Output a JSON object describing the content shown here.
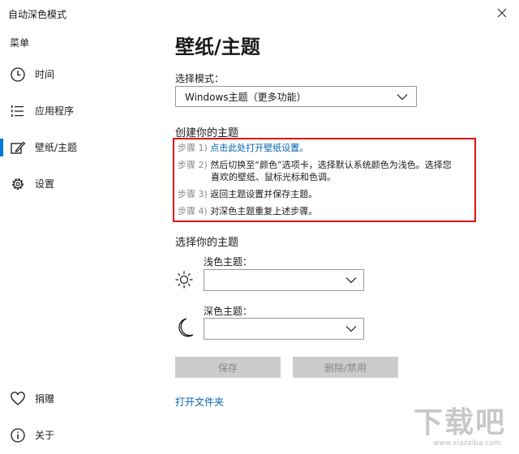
{
  "window": {
    "title": "自动深色模式"
  },
  "sidebar": {
    "menu_label": "菜单",
    "items": [
      {
        "label": "时间",
        "icon": "clock-icon"
      },
      {
        "label": "应用程序",
        "icon": "list-icon"
      },
      {
        "label": "壁纸/主题",
        "icon": "edit-icon",
        "selected": true
      },
      {
        "label": "设置",
        "icon": "gear-icon"
      }
    ],
    "bottom_items": [
      {
        "label": "捐赠",
        "icon": "heart-icon"
      },
      {
        "label": "关于",
        "icon": "info-icon"
      }
    ]
  },
  "main": {
    "title": "壁纸/主题",
    "mode_label": "选择模式：",
    "mode_value": "Windows主题（更多功能）",
    "create_heading": "创建你的主题",
    "steps": [
      {
        "num": "步骤 1)",
        "text": "点击此处打开壁纸设置。",
        "is_link": true
      },
      {
        "num": "步骤 2)",
        "text_line1": "然后切换至“颜色”选项卡，选择默认系统颜色为浅色。选择您",
        "text_line2": "喜欢的壁纸、鼠标光标和色调。"
      },
      {
        "num": "步骤 3)",
        "text": "返回主题设置并保存主题。"
      },
      {
        "num": "步骤 4)",
        "text": "对深色主题重复上述步骤。"
      }
    ],
    "choose_heading": "选择你的主题",
    "light_label": "浅色主题：",
    "light_value": "",
    "dark_label": "深色主题：",
    "dark_value": "",
    "save_label": "保存",
    "delete_label": "删除/禁用",
    "open_folder_label": "打开文件夹"
  },
  "colors": {
    "accent": "#0078d7",
    "link": "#0063b1",
    "highlight_border": "#e01010",
    "button_disabled_bg": "#cccccc"
  },
  "watermark": {
    "line1": "下载吧",
    "line2": "www.xiazaiba.com"
  }
}
